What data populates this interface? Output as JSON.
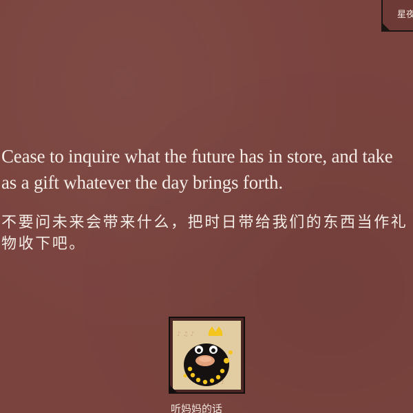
{
  "corner_card": {
    "label": "星夜"
  },
  "quote": {
    "english": "Cease to inquire what the future has in store, and take as a gift whatever the day brings forth.",
    "chinese": "不要问未来会带来什么，把时日带给我们的东西当作礼物收下吧。"
  },
  "thumbnail": {
    "caption": "听妈妈的话",
    "icon": "cartoon-bird-icon"
  },
  "colors": {
    "background": "#7a433e",
    "text": "#f6ece6",
    "card_border": "#1b1514"
  }
}
